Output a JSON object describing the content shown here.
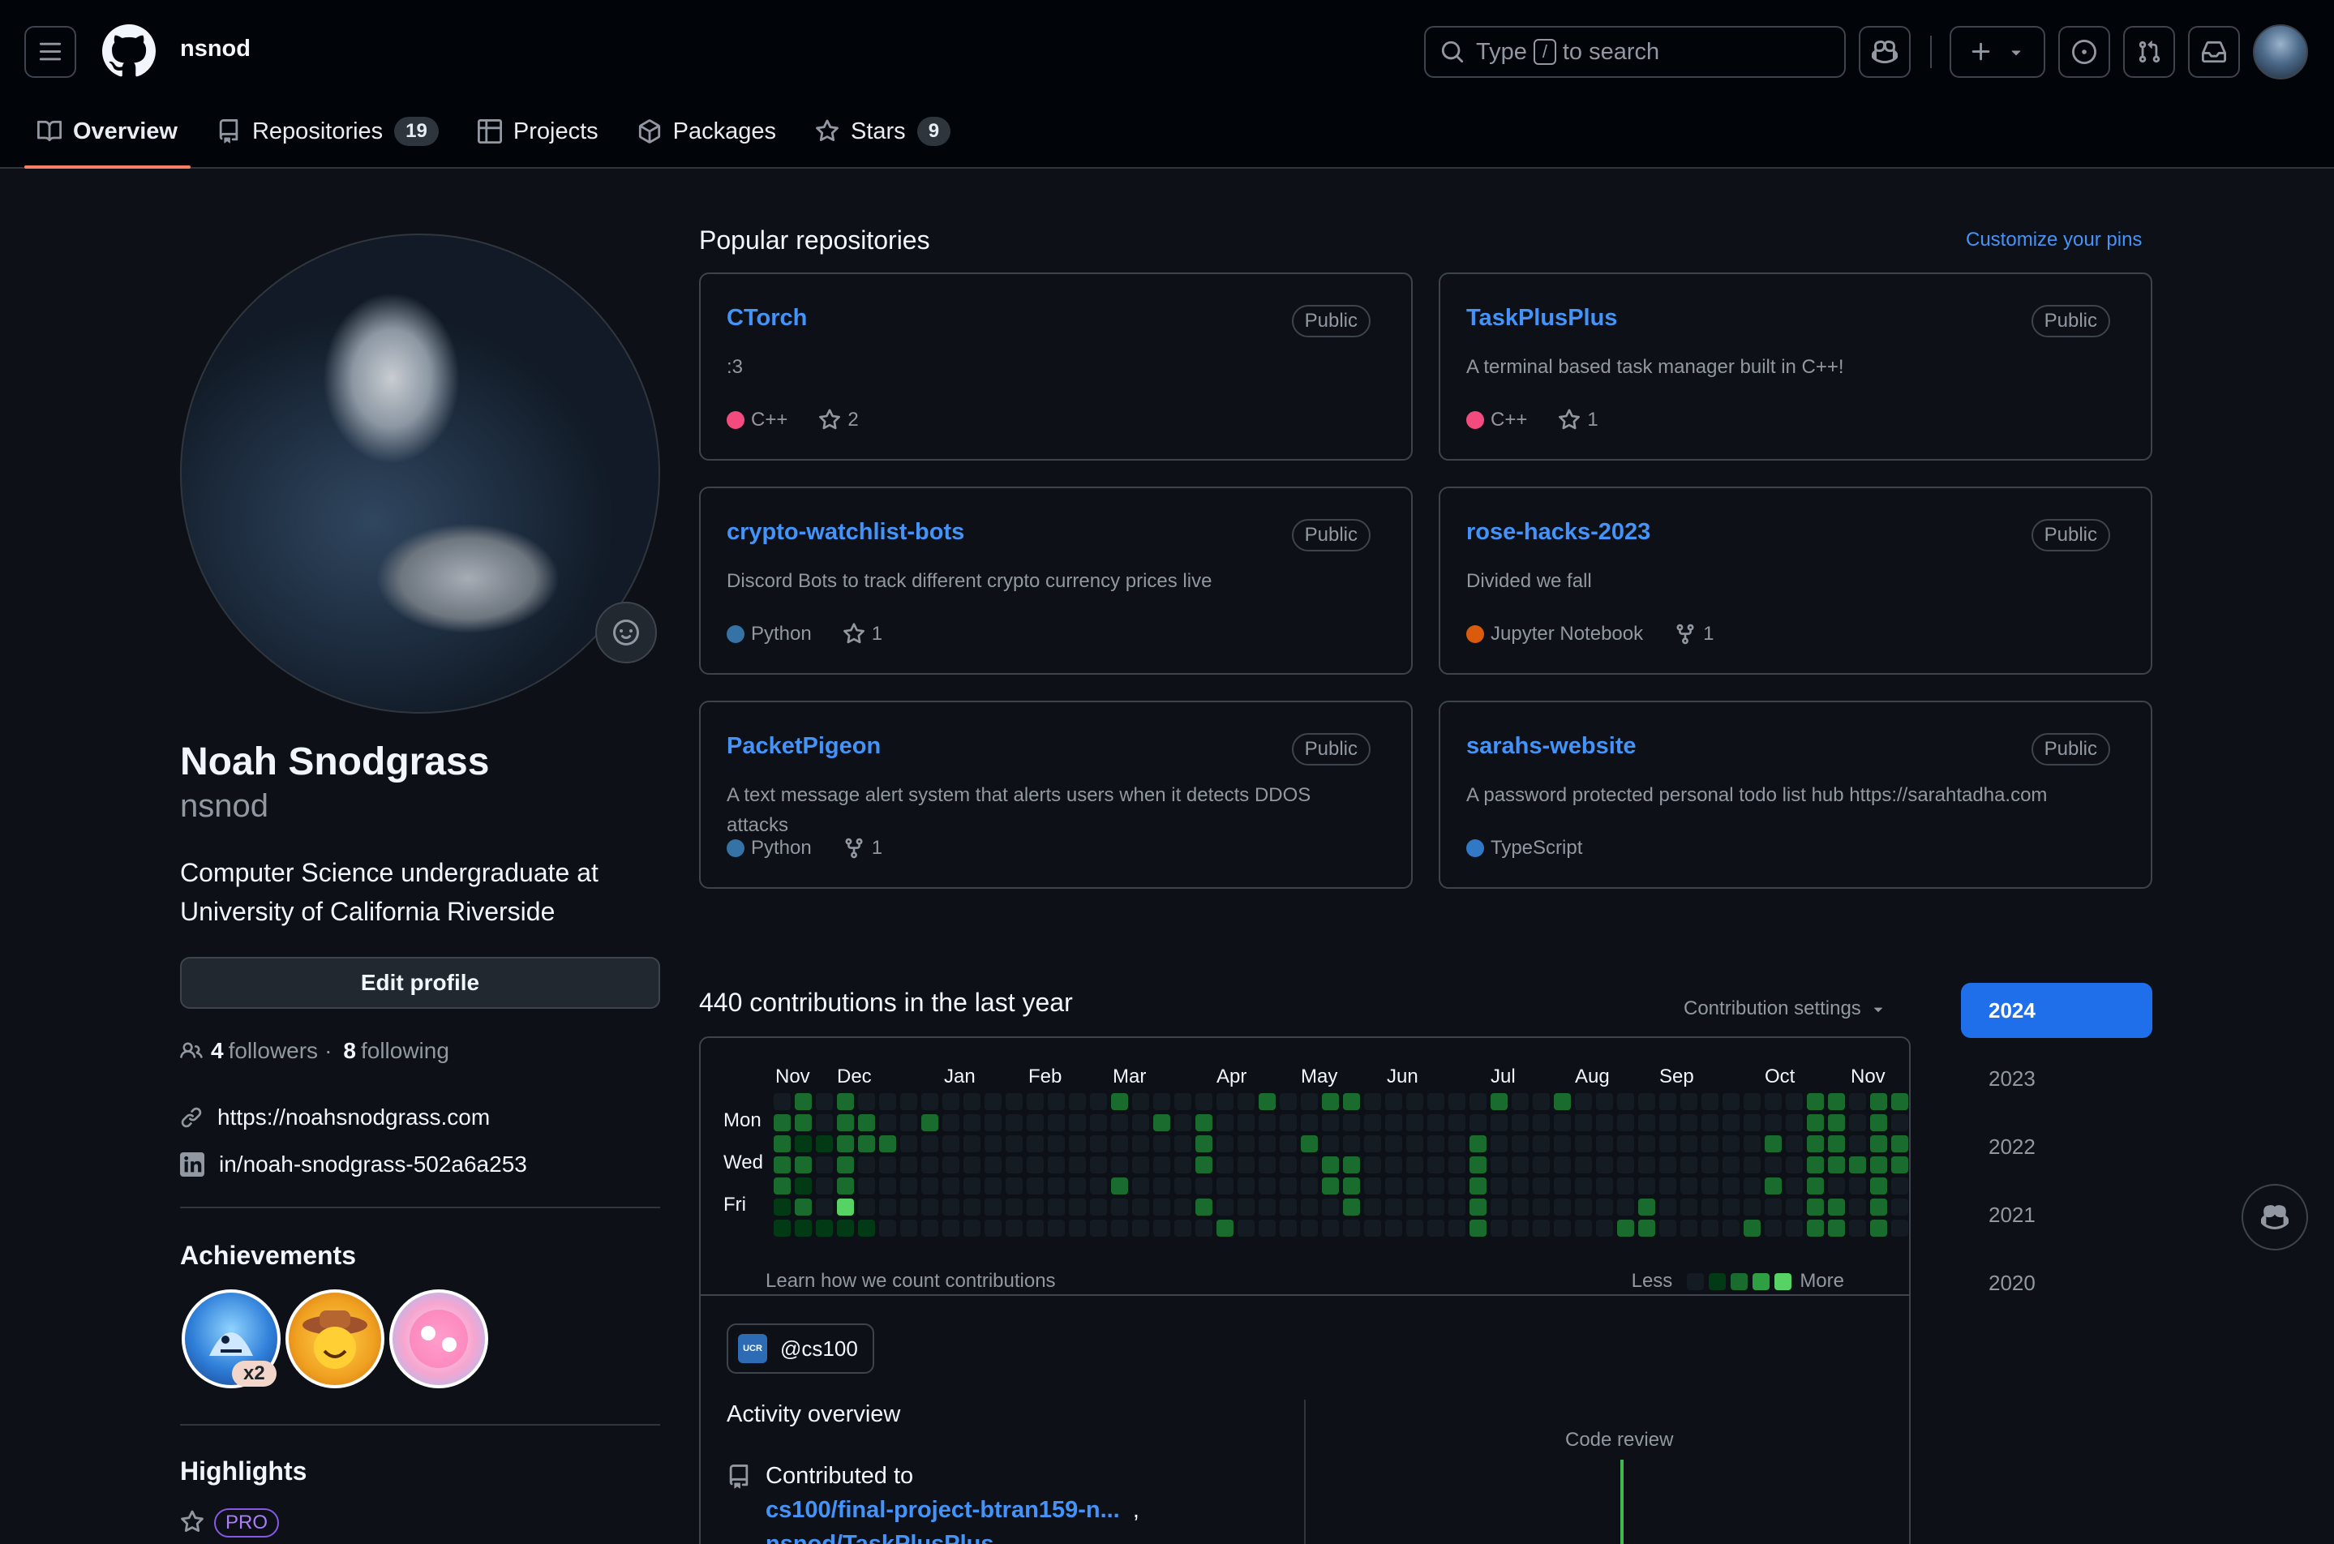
{
  "header": {
    "owner": "nsnod",
    "search": {
      "prefix": "Type",
      "key": "/",
      "suffix": "to search"
    }
  },
  "tabs": [
    {
      "label": "Overview",
      "active": true
    },
    {
      "label": "Repositories",
      "count": "19"
    },
    {
      "label": "Projects"
    },
    {
      "label": "Packages"
    },
    {
      "label": "Stars",
      "count": "9"
    }
  ],
  "profile": {
    "name": "Noah Snodgrass",
    "login": "nsnod",
    "bio": "Computer Science undergraduate at University of California Riverside",
    "edit_label": "Edit profile",
    "followers": "4",
    "followers_label": "followers",
    "separator": "·",
    "following": "8",
    "following_label": "following",
    "website": "https://noahsnodgrass.com",
    "linkedin": "in/noah-snodgrass-502a6a253"
  },
  "achievements": {
    "title": "Achievements",
    "multiplier": "x2"
  },
  "highlights": {
    "title": "Highlights",
    "pro": "PRO"
  },
  "popular": {
    "title": "Popular repositories",
    "customize": "Customize your pins",
    "repos": [
      {
        "name": "CTorch",
        "visibility": "Public",
        "desc": ":3",
        "lang": "C++",
        "lang_color": "#f34b7d",
        "stat_type": "star",
        "stat": "2"
      },
      {
        "name": "TaskPlusPlus",
        "visibility": "Public",
        "desc": "A terminal based task manager built in C++!",
        "lang": "C++",
        "lang_color": "#f34b7d",
        "stat_type": "star",
        "stat": "1"
      },
      {
        "name": "crypto-watchlist-bots",
        "visibility": "Public",
        "desc": "Discord Bots to track different crypto currency prices live",
        "lang": "Python",
        "lang_color": "#3572A5",
        "stat_type": "star",
        "stat": "1"
      },
      {
        "name": "rose-hacks-2023",
        "visibility": "Public",
        "desc": "Divided we fall",
        "lang": "Jupyter Notebook",
        "lang_color": "#DA5B0B",
        "stat_type": "fork",
        "stat": "1"
      },
      {
        "name": "PacketPigeon",
        "visibility": "Public",
        "desc": "A text message alert system that alerts users when it detects DDOS attacks",
        "lang": "Python",
        "lang_color": "#3572A5",
        "stat_type": "fork",
        "stat": "1"
      },
      {
        "name": "sarahs-website",
        "visibility": "Public",
        "desc": "A password protected personal todo list hub https://sarahtadha.com",
        "lang": "TypeScript",
        "lang_color": "#3178c6",
        "stat_type": "",
        "stat": ""
      }
    ]
  },
  "contributions": {
    "title": "440 contributions in the last year",
    "settings": "Contribution settings",
    "months": [
      "Nov",
      "Dec",
      "Jan",
      "Feb",
      "Mar",
      "Apr",
      "May",
      "Jun",
      "Jul",
      "Aug",
      "Sep",
      "Oct",
      "Nov"
    ],
    "days": [
      "Mon",
      "Wed",
      "Fri"
    ],
    "learn": "Learn how we count contributions",
    "less": "Less",
    "more": "More",
    "colors": [
      "#151b23",
      "#033a16",
      "#196c2e",
      "#2ea043",
      "#56d364"
    ],
    "levels": [
      [
        0,
        2,
        2,
        2,
        2,
        1,
        1
      ],
      [
        2,
        2,
        1,
        2,
        1,
        2,
        1
      ],
      [
        0,
        0,
        1,
        0,
        0,
        0,
        1
      ],
      [
        2,
        2,
        2,
        2,
        2,
        4,
        1
      ],
      [
        0,
        2,
        2,
        0,
        0,
        0,
        1
      ],
      [
        0,
        0,
        2,
        0,
        0,
        0,
        0
      ],
      [
        0,
        0,
        0,
        0,
        0,
        0,
        0
      ],
      [
        0,
        2,
        0,
        0,
        0,
        0,
        0
      ],
      [
        0,
        0,
        0,
        0,
        0,
        0,
        0
      ],
      [
        0,
        0,
        0,
        0,
        0,
        0,
        0
      ],
      [
        0,
        0,
        0,
        0,
        0,
        0,
        0
      ],
      [
        0,
        0,
        0,
        0,
        0,
        0,
        0
      ],
      [
        0,
        0,
        0,
        0,
        0,
        0,
        0
      ],
      [
        0,
        0,
        0,
        0,
        0,
        0,
        0
      ],
      [
        0,
        0,
        0,
        0,
        0,
        0,
        0
      ],
      [
        0,
        0,
        0,
        0,
        0,
        0,
        0
      ],
      [
        2,
        0,
        0,
        0,
        2,
        0,
        0
      ],
      [
        0,
        0,
        0,
        0,
        0,
        0,
        0
      ],
      [
        0,
        2,
        0,
        0,
        0,
        0,
        0
      ],
      [
        0,
        0,
        0,
        0,
        0,
        0,
        0
      ],
      [
        0,
        2,
        2,
        2,
        0,
        2,
        0
      ],
      [
        0,
        0,
        0,
        0,
        0,
        0,
        2
      ],
      [
        0,
        0,
        0,
        0,
        0,
        0,
        0
      ],
      [
        2,
        0,
        0,
        0,
        0,
        0,
        0
      ],
      [
        0,
        0,
        0,
        0,
        0,
        0,
        0
      ],
      [
        0,
        0,
        2,
        0,
        0,
        0,
        0
      ],
      [
        2,
        0,
        0,
        2,
        2,
        0,
        0
      ],
      [
        2,
        0,
        0,
        2,
        2,
        2,
        0
      ],
      [
        0,
        0,
        0,
        0,
        0,
        0,
        0
      ],
      [
        0,
        0,
        0,
        0,
        0,
        0,
        0
      ],
      [
        0,
        0,
        0,
        0,
        0,
        0,
        0
      ],
      [
        0,
        0,
        0,
        0,
        0,
        0,
        0
      ],
      [
        0,
        0,
        0,
        0,
        0,
        0,
        0
      ],
      [
        0,
        0,
        2,
        2,
        2,
        2,
        2
      ],
      [
        2,
        0,
        0,
        0,
        0,
        0,
        0
      ],
      [
        0,
        0,
        0,
        0,
        0,
        0,
        0
      ],
      [
        0,
        0,
        0,
        0,
        0,
        0,
        0
      ],
      [
        2,
        0,
        0,
        0,
        0,
        0,
        0
      ],
      [
        0,
        0,
        0,
        0,
        0,
        0,
        0
      ],
      [
        0,
        0,
        0,
        0,
        0,
        0,
        0
      ],
      [
        0,
        0,
        0,
        0,
        0,
        0,
        2
      ],
      [
        0,
        0,
        0,
        0,
        0,
        2,
        2
      ],
      [
        0,
        0,
        0,
        0,
        0,
        0,
        0
      ],
      [
        0,
        0,
        0,
        0,
        0,
        0,
        0
      ],
      [
        0,
        0,
        0,
        0,
        0,
        0,
        0
      ],
      [
        0,
        0,
        0,
        0,
        0,
        0,
        0
      ],
      [
        0,
        0,
        0,
        0,
        0,
        0,
        2
      ],
      [
        0,
        0,
        2,
        0,
        2,
        0,
        0
      ],
      [
        0,
        0,
        0,
        0,
        0,
        0,
        0
      ],
      [
        2,
        2,
        2,
        2,
        2,
        2,
        2
      ],
      [
        2,
        2,
        2,
        2,
        0,
        2,
        2
      ],
      [
        0,
        0,
        0,
        2,
        0,
        0,
        0
      ],
      [
        2,
        2,
        2,
        2,
        2,
        2,
        2
      ],
      [
        2,
        0,
        2,
        2,
        0,
        0,
        0
      ]
    ]
  },
  "activity": {
    "org": "@cs100",
    "org_logo": "UCR",
    "overview": "Activity overview",
    "contributed": "Contributed to",
    "link1": "cs100/final-project-btran159-n...",
    "comma": ",",
    "link2": "nsnod/TaskPlusPlus",
    "code_review": "Code review"
  },
  "years": [
    "2024",
    "2023",
    "2022",
    "2021",
    "2020"
  ]
}
